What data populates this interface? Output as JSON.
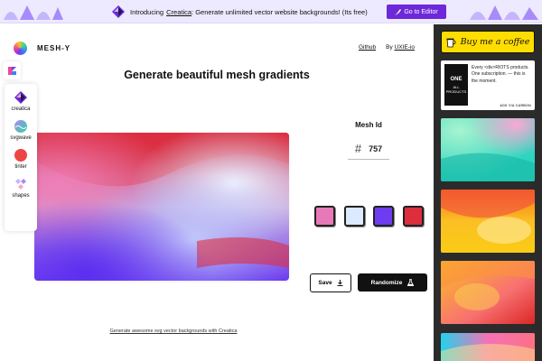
{
  "banner": {
    "intro": "Introducing",
    "product_link": "Creatica",
    "message": ": Generate unlimited vector website backgrounds! (Its free)",
    "editor_button": "Go to Editor"
  },
  "header": {
    "brand": "MESH-Y",
    "links": [
      {
        "label": "Github"
      },
      {
        "label_prefix": "By",
        "label": "UXIE-io"
      }
    ]
  },
  "main": {
    "headline": "Generate beautiful mesh gradients",
    "mesh_id_label": "Mesh Id",
    "mesh_id_hash": "#",
    "mesh_id_value": "757",
    "palette": [
      "#e879b8",
      "#dbeafe",
      "#6d3cf0",
      "#dc2e3d"
    ],
    "save_label": "Save",
    "randomize_label": "Randomize",
    "footer_link": "Generate awesome svg vector backgrounds with Creatica"
  },
  "tools": {
    "items": [
      {
        "label": "creatica",
        "icon": "creatica-icon"
      },
      {
        "label": "svgwave",
        "icon": "svgwave-icon"
      },
      {
        "label": "tinter",
        "icon": "tinter-icon"
      },
      {
        "label": "shapes",
        "icon": "shapes-icon"
      }
    ]
  },
  "sidebar": {
    "coffee_label": "Buy me a coffee",
    "ad": {
      "image_text_top": "ONE",
      "image_text_bottom": "ALL PRODUCTS",
      "text": "Every <div>RIOTS products. One subscription. — this is the moment.",
      "via": "ADS VIA CARBON"
    }
  },
  "colors": {
    "accent": "#6d28d9",
    "banner_bg": "#ede9fe",
    "sidebar_bg": "#2b2b2b",
    "coffee_yellow": "#ffdd00"
  }
}
